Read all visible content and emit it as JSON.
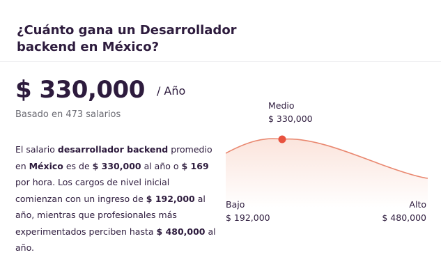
{
  "header": {
    "title": "¿Cuánto gana un Desarrollador backend en México?"
  },
  "salary": {
    "amount": "$ 330,000",
    "period": "/ Año",
    "based_on": "Basado en 473 salarios"
  },
  "description": {
    "t1": "El salario ",
    "b1": "desarrollador backend",
    "t2": " promedio en ",
    "b2": "México",
    "t3": " es de ",
    "b3": "$ 330,000",
    "t4": " al año o ",
    "b4": "$ 169",
    "t5": " por hora. Los cargos de nivel inicial comienzan con un ingreso de ",
    "b5": "$ 192,000",
    "t6": " al año, mientras que profesionales más experimentados perciben hasta ",
    "b6": "$ 480,000",
    "t7": " al año."
  },
  "range": {
    "medio_label": "Medio",
    "medio_value": "$ 330,000",
    "bajo_label": "Bajo",
    "bajo_value": "$ 192,000",
    "alto_label": "Alto",
    "alto_value": "$ 480,000"
  },
  "colors": {
    "accent": "#e8523f",
    "curve": "#e9876f",
    "fill_top": "#fbe4dc"
  }
}
